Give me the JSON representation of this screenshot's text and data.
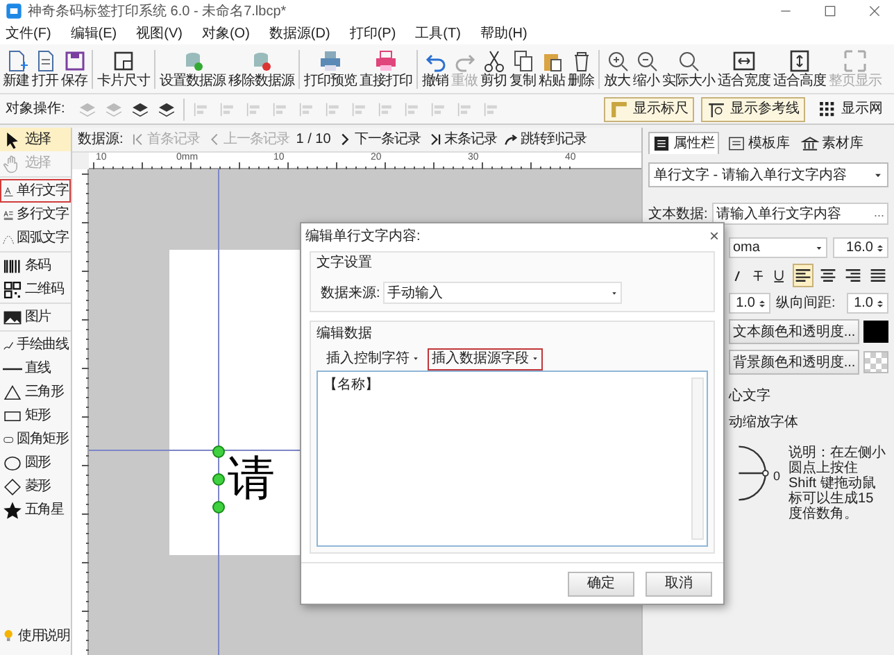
{
  "window": {
    "title": "神奇条码标签打印系统 6.0 - 未命名7.lbcp*"
  },
  "menu": [
    "文件(F)",
    "编辑(E)",
    "视图(V)",
    "对象(O)",
    "数据源(D)",
    "打印(P)",
    "工具(T)",
    "帮助(H)"
  ],
  "toolbar": {
    "groups": [
      [
        {
          "label": "新建",
          "disabled": false
        },
        {
          "label": "打开",
          "disabled": false
        },
        {
          "label": "保存",
          "disabled": false
        }
      ],
      [
        {
          "label": "卡片尺寸",
          "disabled": false
        }
      ],
      [
        {
          "label": "设置数据源",
          "disabled": false
        },
        {
          "label": "移除数据源",
          "disabled": false
        }
      ],
      [
        {
          "label": "打印预览",
          "disabled": false
        },
        {
          "label": "直接打印",
          "disabled": false
        }
      ],
      [
        {
          "label": "撤销",
          "disabled": false
        },
        {
          "label": "重做",
          "disabled": true
        },
        {
          "label": "剪切",
          "disabled": false
        },
        {
          "label": "复制",
          "disabled": false
        },
        {
          "label": "粘贴",
          "disabled": false
        },
        {
          "label": "删除",
          "disabled": false
        }
      ],
      [
        {
          "label": "放大",
          "disabled": false
        },
        {
          "label": "缩小",
          "disabled": false
        },
        {
          "label": "实际大小",
          "disabled": false
        },
        {
          "label": "适合宽度",
          "disabled": false
        },
        {
          "label": "适合高度",
          "disabled": false
        },
        {
          "label": "整页显示",
          "disabled": true
        }
      ]
    ]
  },
  "object_bar": {
    "label": "对象操作:",
    "toggles": [
      {
        "label": "显示标尺",
        "on": true
      },
      {
        "label": "显示参考线",
        "on": true
      },
      {
        "label": "显示网",
        "on": false
      }
    ]
  },
  "toolbox": {
    "groups": [
      [
        {
          "label": "选择",
          "selected": true,
          "disabled": false,
          "highlighted": false
        },
        {
          "label": "选择",
          "selected": false,
          "disabled": true,
          "highlighted": false
        }
      ],
      [
        {
          "label": "单行文字",
          "selected": false,
          "disabled": false,
          "highlighted": true
        },
        {
          "label": "多行文字",
          "selected": false,
          "disabled": false,
          "highlighted": false
        },
        {
          "label": "圆弧文字",
          "selected": false,
          "disabled": false,
          "highlighted": false
        }
      ],
      [
        {
          "label": "条码",
          "selected": false,
          "disabled": false,
          "highlighted": false
        },
        {
          "label": "二维码",
          "selected": false,
          "disabled": false,
          "highlighted": false
        }
      ],
      [
        {
          "label": "图片",
          "selected": false,
          "disabled": false,
          "highlighted": false
        }
      ],
      [
        {
          "label": "手绘曲线",
          "selected": false,
          "disabled": false,
          "highlighted": false
        },
        {
          "label": "直线",
          "selected": false,
          "disabled": false,
          "highlighted": false
        },
        {
          "label": "三角形",
          "selected": false,
          "disabled": false,
          "highlighted": false
        },
        {
          "label": "矩形",
          "selected": false,
          "disabled": false,
          "highlighted": false
        },
        {
          "label": "圆角矩形",
          "selected": false,
          "disabled": false,
          "highlighted": false
        },
        {
          "label": "圆形",
          "selected": false,
          "disabled": false,
          "highlighted": false
        },
        {
          "label": "菱形",
          "selected": false,
          "disabled": false,
          "highlighted": false
        },
        {
          "label": "五角星",
          "selected": false,
          "disabled": false,
          "highlighted": false
        }
      ]
    ],
    "help": "使用说明"
  },
  "record_nav": {
    "label": "数据源:",
    "before": [
      {
        "label": "首条记录",
        "disabled": true
      },
      {
        "label": "上一条记录",
        "disabled": true
      }
    ],
    "position": "1 / 10",
    "after": [
      {
        "label": "下一条记录",
        "disabled": false
      },
      {
        "label": "末条记录",
        "disabled": false
      },
      {
        "label": "跳转到记录",
        "disabled": false
      }
    ]
  },
  "ruler": {
    "labels": [
      "10",
      "0mm",
      "10",
      "20",
      "30",
      "40"
    ]
  },
  "canvas": {
    "text": "请"
  },
  "dialog": {
    "title": "编辑单行文字内容:",
    "close": "×",
    "section": "文字设置",
    "source_label": "数据来源:",
    "source_value": "手动输入",
    "edit_section": "编辑数据",
    "insert_buttons": [
      {
        "label": "插入控制字符",
        "highlighted": false
      },
      {
        "label": "插入数据源字段",
        "highlighted": true
      }
    ],
    "content": "【名称】",
    "buttons": [
      "确定",
      "取消"
    ]
  },
  "properties": {
    "tabs": [
      {
        "label": "属性栏",
        "selected": true
      },
      {
        "label": "模板库",
        "selected": false
      },
      {
        "label": "素材库",
        "selected": false
      }
    ],
    "object_select": "单行文字 - 请输入单行文字内容",
    "text_data_label": "文本数据:",
    "text_data_value": "请输入单行文字内容",
    "browse": "...",
    "font": "oma",
    "font_size": "16.0",
    "align_buttons": [
      {
        "selected": true
      },
      {
        "selected": false
      },
      {
        "selected": false
      },
      {
        "selected": false
      }
    ],
    "char_spacing": "1.0",
    "line_spacing_label": "纵向间距:",
    "line_spacing": "1.0",
    "text_color_button": "文本颜色和透明度...",
    "background_color_button": "背景颜色和透明度...",
    "option_1": "心文字",
    "option_2": "动缩放字体",
    "angle": "0",
    "note": "说明：在左侧小圆点上按住 Shift 键拖动鼠标可以生成15度倍数角。"
  }
}
